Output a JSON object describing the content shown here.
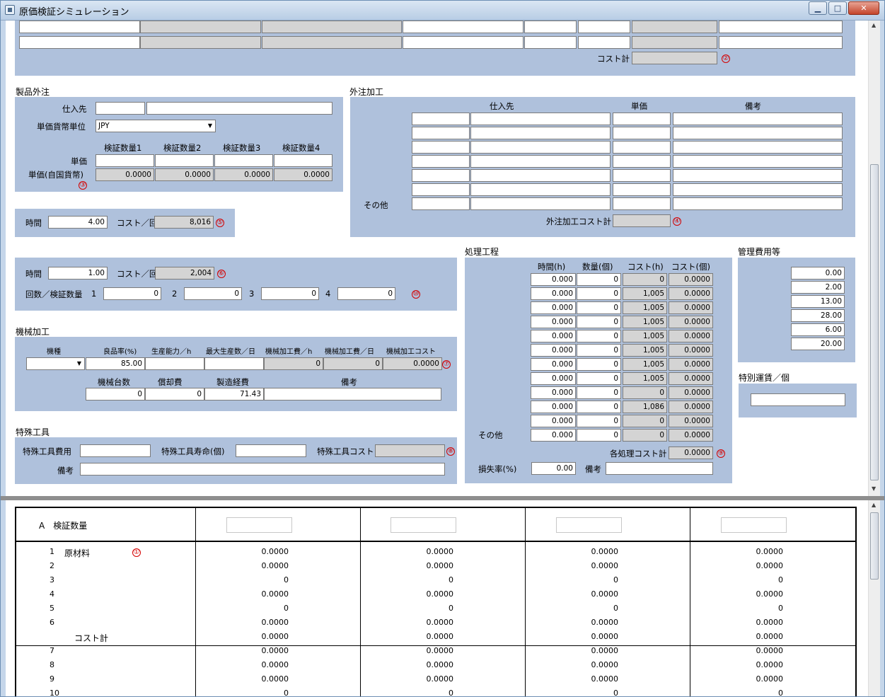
{
  "window": {
    "title": "原価検証シミュレーション",
    "min": "▁",
    "max": "□",
    "close": "✕"
  },
  "top": {
    "cost_total_label": "コスト計",
    "cost_total_value": "",
    "marker": "②"
  },
  "outsourced_product": {
    "title": "製品外注",
    "supplier_label": "仕入先",
    "supplier_code": "",
    "supplier_name": "",
    "currency_label": "単価貨幣単位",
    "currency_value": "JPY",
    "qty_headers": [
      "検証数量1",
      "検証数量2",
      "検証数量3",
      "検証数量4"
    ],
    "unit_price_label": "単価",
    "unit_price_values": [
      "",
      "",
      "",
      ""
    ],
    "domestic_label": "単価(自国貨幣)",
    "domestic_values": [
      "0.0000",
      "0.0000",
      "0.0000",
      "0.0000"
    ],
    "marker": "③"
  },
  "time_block1": {
    "time_label": "時間",
    "time_value": "4.00",
    "cost_label": "コスト／回",
    "cost_value": "8,016",
    "marker": "⑤"
  },
  "time_block2": {
    "time_label": "時間",
    "time_value": "1.00",
    "cost_label": "コスト／回",
    "cost_value": "2,004",
    "marker": "⑥",
    "count_label": "回数／検証数量",
    "idx": [
      "1",
      "2",
      "3",
      "4"
    ],
    "counts": [
      "0",
      "0",
      "0",
      "0"
    ],
    "marker2": "⑩"
  },
  "outsource_processing": {
    "title": "外注加工",
    "headers": {
      "supplier": "仕入先",
      "price": "単価",
      "note": "備考"
    },
    "other_label": "その他",
    "total_label": "外注加工コスト計",
    "total_value": "",
    "marker": "④"
  },
  "machining": {
    "title": "機械加工",
    "headers": [
      "機種",
      "良品率(%)",
      "生産能力／h",
      "最大生産数／日",
      "機械加工費／h",
      "機械加工費／日",
      "機械加工コスト"
    ],
    "values": {
      "type": "",
      "yield": "85.00",
      "capacity": "",
      "max_daily": "",
      "cost_h": "0",
      "cost_day": "0",
      "cost": "0.0000"
    },
    "marker": "⑦",
    "headers2": [
      "機械台数",
      "償却費",
      "製造経費",
      "備考"
    ],
    "values2": {
      "units": "0",
      "depreciation": "0",
      "overhead": "71.43",
      "note": ""
    }
  },
  "special_tools": {
    "title": "特殊工具",
    "cost_label": "特殊工具費用",
    "cost_value": "",
    "life_label": "特殊工具寿命(個)",
    "life_value": "",
    "tool_cost_label": "特殊工具コスト",
    "tool_cost_value": "",
    "marker": "⑧",
    "note_label": "備考",
    "note_value": ""
  },
  "process": {
    "title": "処理工程",
    "headers": [
      "時間(h)",
      "数量(個)",
      "コスト(h)",
      "コスト(個)"
    ],
    "rows": [
      [
        "0.000",
        "0",
        "0",
        "0.0000"
      ],
      [
        "0.000",
        "0",
        "1,005",
        "0.0000"
      ],
      [
        "0.000",
        "0",
        "1,005",
        "0.0000"
      ],
      [
        "0.000",
        "0",
        "1,005",
        "0.0000"
      ],
      [
        "0.000",
        "0",
        "1,005",
        "0.0000"
      ],
      [
        "0.000",
        "0",
        "1,005",
        "0.0000"
      ],
      [
        "0.000",
        "0",
        "1,005",
        "0.0000"
      ],
      [
        "0.000",
        "0",
        "1,005",
        "0.0000"
      ],
      [
        "0.000",
        "0",
        "0",
        "0.0000"
      ],
      [
        "0.000",
        "0",
        "1,086",
        "0.0000"
      ],
      [
        "0.000",
        "0",
        "0",
        "0.0000"
      ],
      [
        "0.000",
        "0",
        "0",
        "0.0000"
      ]
    ],
    "other_label": "その他",
    "total_label": "各処理コスト計",
    "total_value": "0.0000",
    "marker": "⑨",
    "loss_label": "損失率(%)",
    "loss_value": "0.00",
    "note_label": "備考",
    "note_value": ""
  },
  "admin": {
    "title": "管理費用等",
    "values": [
      "0.00",
      "2.00",
      "13.00",
      "28.00",
      "6.00",
      "20.00"
    ]
  },
  "freight": {
    "title": "特別運賃／個",
    "value": ""
  },
  "summary": {
    "header_label": "A　検証数量",
    "rows": [
      {
        "no": "1",
        "label": "原材料",
        "marker": "①",
        "vals": [
          "0.0000",
          "0.0000",
          "0.0000",
          "0.0000"
        ]
      },
      {
        "no": "2",
        "label": "",
        "marker": "",
        "vals": [
          "0.0000",
          "0.0000",
          "0.0000",
          "0.0000"
        ]
      },
      {
        "no": "3",
        "label": "",
        "marker": "",
        "vals": [
          "0",
          "0",
          "0",
          "0"
        ]
      },
      {
        "no": "4",
        "label": "",
        "marker": "",
        "vals": [
          "0.0000",
          "0.0000",
          "0.0000",
          "0.0000"
        ]
      },
      {
        "no": "5",
        "label": "",
        "marker": "",
        "vals": [
          "0",
          "0",
          "0",
          "0"
        ]
      },
      {
        "no": "6",
        "label": "",
        "marker": "",
        "vals": [
          "0.0000",
          "0.0000",
          "0.0000",
          "0.0000"
        ]
      },
      {
        "no": "",
        "label": "コスト計",
        "marker": "",
        "vals": [
          "0.0000",
          "0.0000",
          "0.0000",
          "0.0000"
        ]
      },
      {
        "no": "7",
        "label": "",
        "marker": "",
        "vals": [
          "0.0000",
          "0.0000",
          "0.0000",
          "0.0000"
        ]
      },
      {
        "no": "8",
        "label": "",
        "marker": "",
        "vals": [
          "0.0000",
          "0.0000",
          "0.0000",
          "0.0000"
        ]
      },
      {
        "no": "9",
        "label": "",
        "marker": "",
        "vals": [
          "0.0000",
          "0.0000",
          "0.0000",
          "0.0000"
        ]
      },
      {
        "no": "10",
        "label": "",
        "marker": "",
        "vals": [
          "0",
          "0",
          "0",
          "0"
        ]
      }
    ]
  }
}
